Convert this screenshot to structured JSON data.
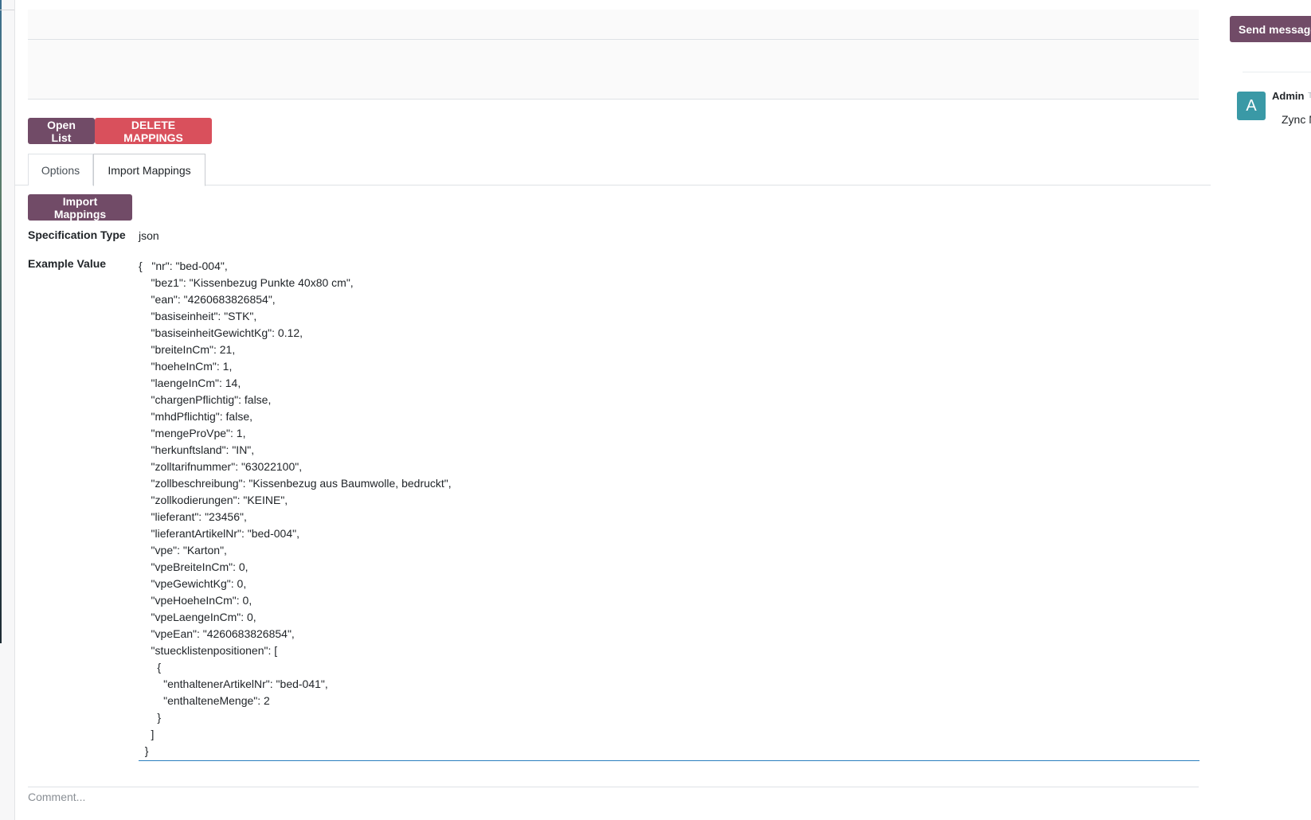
{
  "form": {
    "buttons": {
      "open_list": "Open List",
      "delete_mappings": "DELETE MAPPINGS"
    },
    "tabs": [
      {
        "label": "Options",
        "active": false
      },
      {
        "label": "Import Mappings",
        "active": true
      }
    ],
    "import_button": "Import Mappings",
    "fields": {
      "spec_type_label": "Specification Type",
      "spec_type_value": "json",
      "example_value_label": "Example Value",
      "example_value": "{   \"nr\": \"bed-004\",\n    \"bez1\": \"Kissenbezug Punkte 40x80 cm\",\n    \"ean\": \"4260683826854\",\n    \"basiseinheit\": \"STK\",\n    \"basiseinheitGewichtKg\": 0.12,\n    \"breiteInCm\": 21,\n    \"hoeheInCm\": 1,\n    \"laengeInCm\": 14,\n    \"chargenPflichtig\": false,\n    \"mhdPflichtig\": false,\n    \"mengeProVpe\": 1,\n    \"herkunftsland\": \"IN\",\n    \"zolltarifnummer\": \"63022100\",\n    \"zollbeschreibung\": \"Kissenbezug aus Baumwolle, bedruckt\",\n    \"zollkodierungen\": \"KEINE\",\n    \"lieferant\": \"23456\",\n    \"lieferantArtikelNr\": \"bed-004\",\n    \"vpe\": \"Karton\",\n    \"vpeBreiteInCm\": 0,\n    \"vpeGewichtKg\": 0,\n    \"vpeHoeheInCm\": 0,\n    \"vpeLaengeInCm\": 0,\n    \"vpeEan\": \"4260683826854\",\n    \"stuecklistenpositionen\": [\n      {\n        \"enthaltenerArtikelNr\": \"bed-041\",\n        \"enthalteneMenge\": 2\n      }\n    ]\n  }"
    },
    "comment_placeholder": "Comment..."
  },
  "chatter": {
    "send_message": "Send message",
    "message": {
      "avatar_letter": "A",
      "author": "Admin",
      "date_fragment": "T",
      "body": "Zync M"
    }
  },
  "colors": {
    "primary": "#714b67",
    "danger": "#d9505c",
    "avatar": "#3a99a6",
    "focus_border": "#2b7fbf"
  }
}
